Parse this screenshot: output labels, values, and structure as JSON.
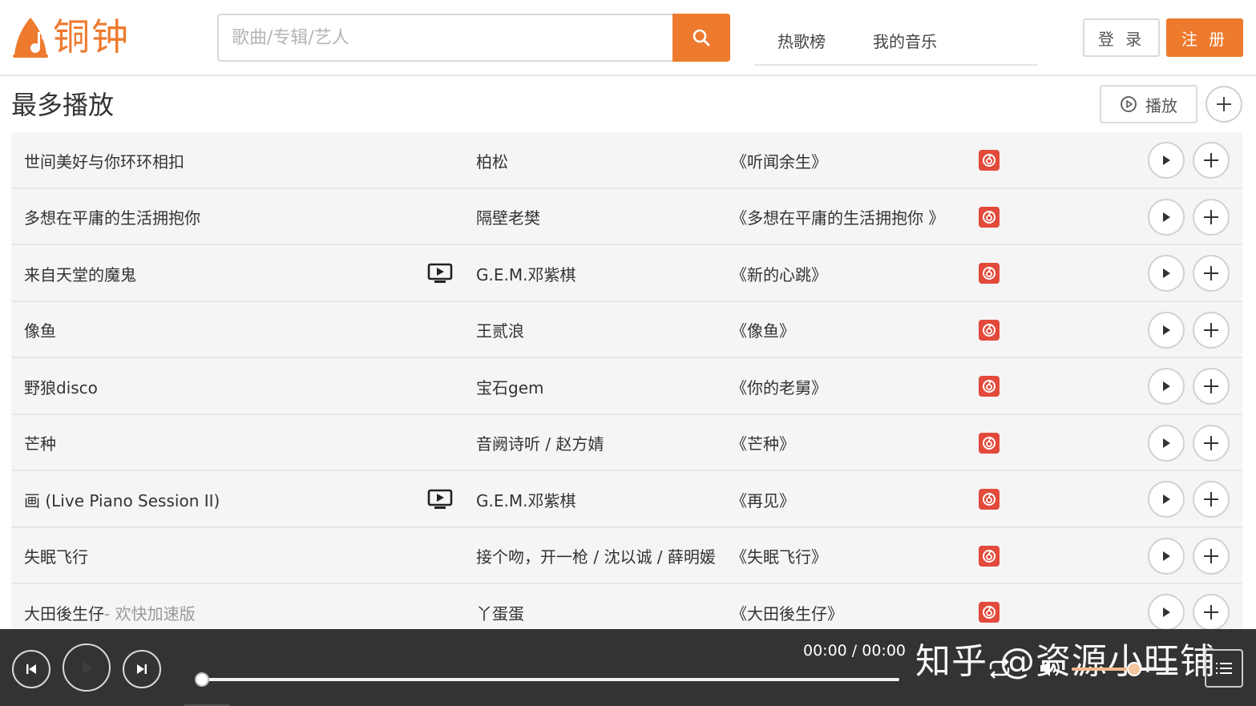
{
  "app": {
    "logo_text": "铜钟",
    "brand_color": "#ee7a2e"
  },
  "search": {
    "placeholder": "歌曲/专辑/艺人",
    "value": "",
    "icon": "search-icon"
  },
  "nav": {
    "items": [
      {
        "label": "热歌榜"
      },
      {
        "label": "我的音乐"
      }
    ]
  },
  "auth": {
    "login_label": "登 录",
    "register_label": "注 册"
  },
  "section": {
    "title": "最多播放",
    "play_all_label": "播放"
  },
  "songs": [
    {
      "title": "世间美好与你环环相扣",
      "subtitle": "",
      "has_mv": false,
      "artist": "柏松",
      "album": "《听闻余生》"
    },
    {
      "title": "多想在平庸的生活拥抱你",
      "subtitle": "",
      "has_mv": false,
      "artist": "隔壁老樊",
      "album": "《多想在平庸的生活拥抱你 》"
    },
    {
      "title": "来自天堂的魔鬼",
      "subtitle": "",
      "has_mv": true,
      "artist": "G.E.M.邓紫棋",
      "album": "《新的心跳》"
    },
    {
      "title": "像鱼",
      "subtitle": "",
      "has_mv": false,
      "artist": "王贰浪",
      "album": "《像鱼》"
    },
    {
      "title": "野狼disco",
      "subtitle": "",
      "has_mv": false,
      "artist": "宝石gem",
      "album": "《你的老舅》"
    },
    {
      "title": "芒种",
      "subtitle": "",
      "has_mv": false,
      "artist": "音阙诗听 / 赵方婧",
      "album": "《芒种》"
    },
    {
      "title": "画 (Live Piano Session II)",
      "subtitle": "",
      "has_mv": true,
      "artist": "G.E.M.邓紫棋",
      "album": "《再见》"
    },
    {
      "title": "失眠飞行",
      "subtitle": "",
      "has_mv": false,
      "artist": "接个吻，开一枪 / 沈以诚 / 薛明媛",
      "album": "《失眠飞行》"
    },
    {
      "title": "大田後生仔",
      "subtitle": " - 欢快加速版",
      "has_mv": false,
      "artist": "丫蛋蛋",
      "album": "《大田後生仔》"
    }
  ],
  "player": {
    "time": "00:00 / 00:00",
    "progress": 0,
    "volume": 0.6,
    "watermark": "知乎 @资源小旺铺"
  }
}
